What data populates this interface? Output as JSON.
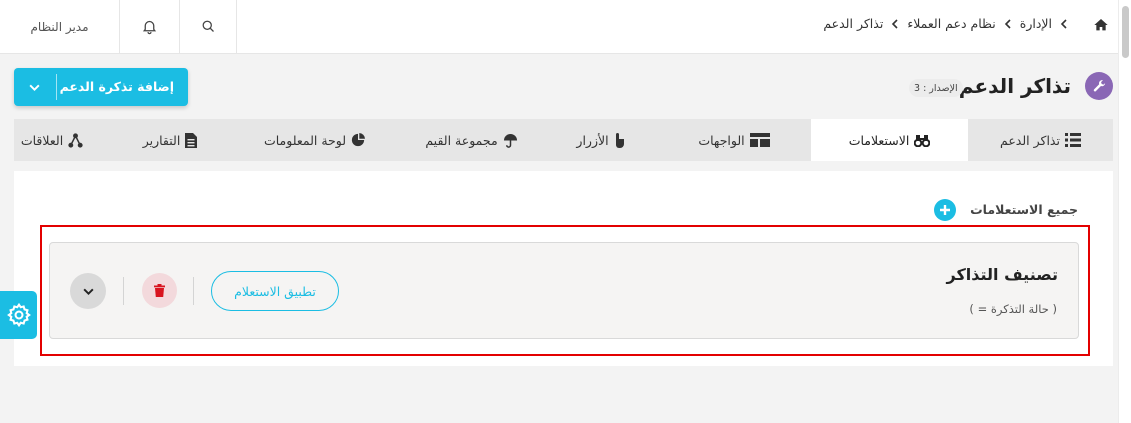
{
  "topbar": {
    "breadcrumbs": [
      "الإدارة",
      "نظام دعم العملاء",
      "تذاكر الدعم"
    ],
    "user": "مدير النظام",
    "icons": [
      "home-icon",
      "bell-icon",
      "search-icon"
    ]
  },
  "page": {
    "title": "تذاكر الدعم",
    "version": "الإصدار : 3",
    "add_button": "إضافة تذكرة الدعم"
  },
  "tabs": [
    {
      "label": "تذاكر الدعم",
      "icon": "list-icon",
      "active": false
    },
    {
      "label": "الاستعلامات",
      "icon": "binoculars-icon",
      "active": true
    },
    {
      "label": "الواجهات",
      "icon": "layout-icon",
      "active": false
    },
    {
      "label": "الأزرار",
      "icon": "pointer-icon",
      "active": false
    },
    {
      "label": "مجموعة القيم",
      "icon": "umbrella-icon",
      "active": false
    },
    {
      "label": "لوحة المعلومات",
      "icon": "pie-chart-icon",
      "active": false
    },
    {
      "label": "التقارير",
      "icon": "report-icon",
      "active": false
    },
    {
      "label": "العلاقات",
      "icon": "relations-icon",
      "active": false
    }
  ],
  "queries": {
    "header": "جميع الاستعلامات",
    "items": [
      {
        "title": "تصنيف التذاكر",
        "condition": "( حالة التذكرة = )",
        "apply_label": "تطبيق الاستعلام"
      }
    ]
  },
  "colors": {
    "accent": "#1bbde3",
    "title_icon": "#8a67b5",
    "highlight_frame": "#e30000",
    "delete_bg": "#f3d9dc",
    "delete_icon": "#d8141f"
  }
}
